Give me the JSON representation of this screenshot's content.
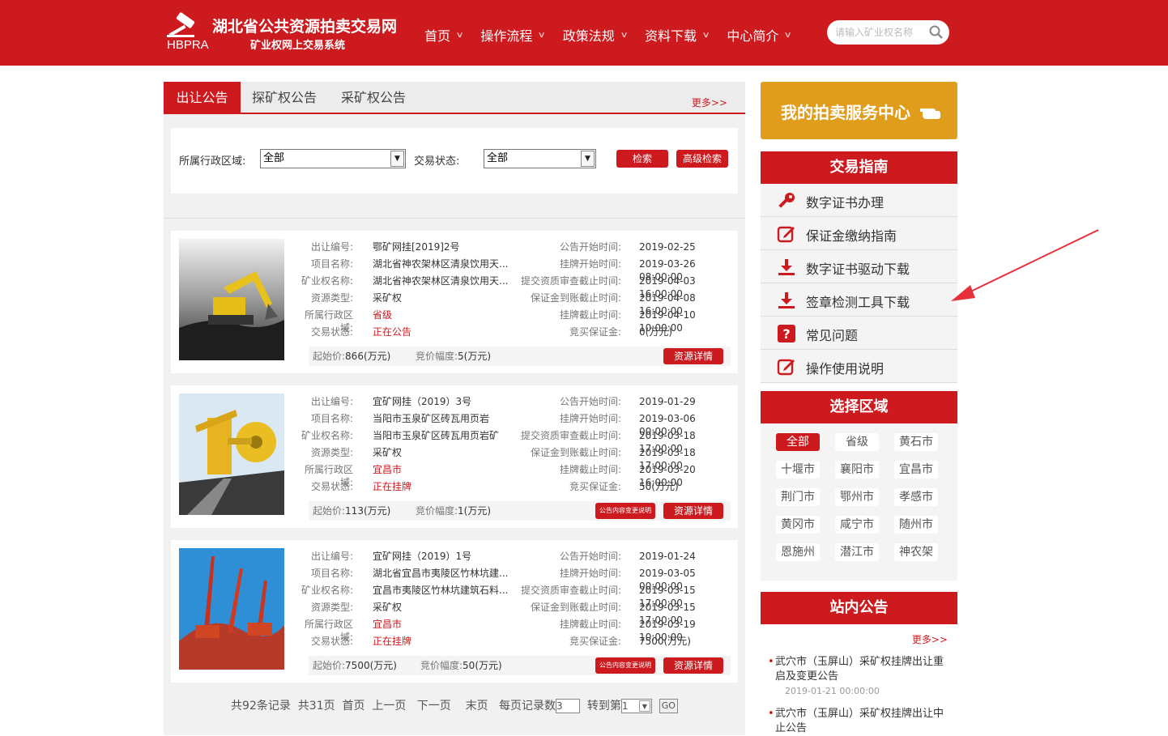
{
  "header": {
    "logo_text": "HBPRA",
    "site_title": "湖北省公共资源拍卖交易网",
    "site_subtitle": "矿业权网上交易系统",
    "nav": [
      "首页",
      "操作流程",
      "政策法规",
      "资料下载",
      "中心简介"
    ],
    "search_placeholder": "请输入矿业权名称"
  },
  "tabs": [
    "出让公告",
    "探矿权公告",
    "采矿权公告"
  ],
  "more": "更多>>",
  "filter": {
    "region_label": "所属行政区域:",
    "region_value": "全部",
    "status_label": "交易状态:",
    "status_value": "全部",
    "search_btn": "检索",
    "advanced_btn": "高级检索"
  },
  "listing_labels": {
    "code": "出让编号:",
    "project": "项目名称:",
    "mine": "矿业权名称:",
    "type": "资源类型:",
    "region": "所属行政区域:",
    "status": "交易状态:",
    "announce_start": "公告开始时间:",
    "listing_start": "挂牌开始时间:",
    "review_deadline": "提交资质审查截止时间:",
    "deposit_deadline": "保证金到账截止时间:",
    "listing_end": "挂牌截止时间:",
    "deposit": "竞买保证金:",
    "start_price": "起始价:",
    "increment": "竞价幅度:",
    "detail_btn": "资源详情",
    "change_btn": "公告内容变更说明"
  },
  "listings": [
    {
      "code": "鄂矿网挂[2019]2号",
      "project": "湖北省神农架林区清泉饮用天...",
      "mine": "湖北省神农架林区清泉饮用天...",
      "type": "采矿权",
      "region": "省级",
      "status": "正在公告",
      "announce_start": "2019-02-25",
      "listing_start": "2019-03-26 08:00:00",
      "review_deadline": "2019-04-03 16:00:00",
      "deposit_deadline": "2019-04-08 16:00:00",
      "listing_end": "2019-04-10 10:00:00",
      "deposit": "0(万元)",
      "start_price": "866(万元)",
      "increment": "5(万元)",
      "has_change": false
    },
    {
      "code": "宜矿网挂（2019）3号",
      "project": "当阳市玉泉矿区砖瓦用页岩",
      "mine": "当阳市玉泉矿区砖瓦用页岩矿",
      "type": "采矿权",
      "region": "宜昌市",
      "status": "正在挂牌",
      "announce_start": "2019-01-29",
      "listing_start": "2019-03-06 00:00:00",
      "review_deadline": "2019-03-18 17:00:00",
      "deposit_deadline": "2019-03-18 17:00:00",
      "listing_end": "2019-03-20 16:00:00",
      "deposit": "50(万元)",
      "start_price": "113(万元)",
      "increment": "1(万元)",
      "has_change": true
    },
    {
      "code": "宜矿网挂（2019）1号",
      "project": "湖北省宜昌市夷陵区竹林坑建...",
      "mine": "宜昌市夷陵区竹林坑建筑石料...",
      "type": "采矿权",
      "region": "宜昌市",
      "status": "正在挂牌",
      "announce_start": "2019-01-24",
      "listing_start": "2019-03-05 00:00:00",
      "review_deadline": "2019-03-15 17:00:00",
      "deposit_deadline": "2019-03-15 17:00:00",
      "listing_end": "2019-03-19 10:00:00",
      "deposit": "7500(万元)",
      "start_price": "7500(万元)",
      "increment": "50(万元)",
      "has_change": true
    }
  ],
  "pager": {
    "total": "共92条记录",
    "pages": "共31页",
    "first": "首页",
    "prev": "上一页",
    "next": "下一页",
    "last": "末页",
    "per_page_label": "每页记录数",
    "per_page_value": "3",
    "goto_label": "转到第",
    "goto_value": "1",
    "go_btn": "GO"
  },
  "sidebar": {
    "service_center": "我的拍卖服务中心",
    "guide_title": "交易指南",
    "guide_items": [
      {
        "label": "数字证书办理",
        "icon": "key-icon"
      },
      {
        "label": "保证金缴纳指南",
        "icon": "edit-icon"
      },
      {
        "label": "数字证书驱动下载",
        "icon": "download-icon"
      },
      {
        "label": "签章检测工具下载",
        "icon": "download-icon"
      },
      {
        "label": "常见问题",
        "icon": "question-icon"
      },
      {
        "label": "操作使用说明",
        "icon": "edit-icon"
      }
    ],
    "region_title": "选择区域",
    "regions": [
      "全部",
      "省级",
      "黄石市",
      "十堰市",
      "襄阳市",
      "宜昌市",
      "荆门市",
      "鄂州市",
      "孝感市",
      "黄冈市",
      "咸宁市",
      "随州市",
      "恩施州",
      "潜江市",
      "神农架"
    ],
    "notice_title": "站内公告",
    "notice_more": "更多>>",
    "notices": [
      {
        "title": "武穴市（玉屏山）采矿权挂牌出让重启及变更公告",
        "date": "2019-01-21 00:00:00"
      },
      {
        "title": "武穴市（玉屏山）采矿权挂牌出让中止公告",
        "date": ""
      }
    ]
  },
  "colors": {
    "brand": "#cd1a1f",
    "service": "#e09d1c"
  }
}
